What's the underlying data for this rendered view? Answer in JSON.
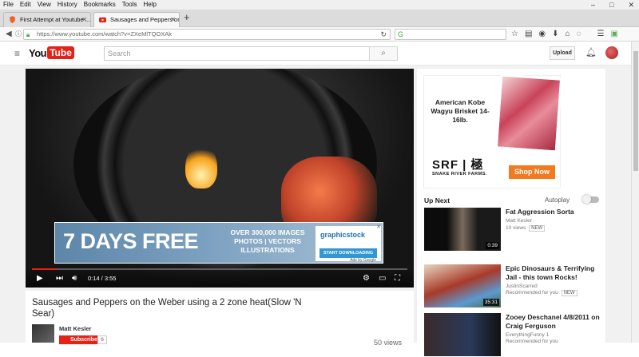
{
  "menu": [
    "File",
    "Edit",
    "View",
    "History",
    "Bookmarks",
    "Tools",
    "Help"
  ],
  "window_controls": [
    "–",
    "□",
    "✕"
  ],
  "tabs": [
    {
      "label": "First Attempt at Youtube ...",
      "close": "✕"
    },
    {
      "label": "Sausages and Peppers on ...",
      "close": "✕"
    }
  ],
  "new_tab": "+",
  "address": {
    "url": "https://www.youtube.com/watch?v=ZXeMlTQOXAk"
  },
  "youtube": {
    "logo_you": "You",
    "logo_tube": "Tube",
    "search_placeholder": "Search",
    "upload": "Upload"
  },
  "ad_banner": {
    "headline": "7 DAYS FREE",
    "middle": "OVER 300,000 IMAGES\nPHOTOS | VECTORS\nILLUSTRATIONS",
    "brand": "graphicstock",
    "cta": "START DOWNLOADING",
    "ads_by": "Ads by Google"
  },
  "player": {
    "time": "0:14 / 3:55",
    "progress": 0.06
  },
  "video": {
    "title": "Sausages and Peppers on the Weber using a 2 zone heat(Slow 'N Sear)",
    "channel": "Matt Kesler",
    "subscribe": "Subscribe",
    "sub_count": "6",
    "views": "50 views"
  },
  "side_ad": {
    "text": "American Kobe Wagyu Brisket 14-16lb.",
    "brand": "SRF | 極",
    "brand_sub": "SNAKE RIVER FARMS.",
    "cta": "Shop Now"
  },
  "upnext": {
    "label": "Up Next",
    "autoplay": "Autoplay"
  },
  "related": [
    {
      "title": "Fat Aggression Sorta",
      "channel": "Matt Kesler",
      "meta": "10 views",
      "badge": "NEW",
      "duration": "0:39"
    },
    {
      "title": "Epic Dinosaurs & Terrifying Jail - this town Rocks!",
      "channel": "JustinScarred",
      "meta": "Recommended for you",
      "badge": "NEW",
      "duration": "35:31"
    },
    {
      "title": "Zooey Deschanel 4/8/2011 on Craig Ferguson",
      "channel": "EverythingFunny 1",
      "meta": "Recommended for you",
      "badge": "",
      "duration": ""
    }
  ]
}
